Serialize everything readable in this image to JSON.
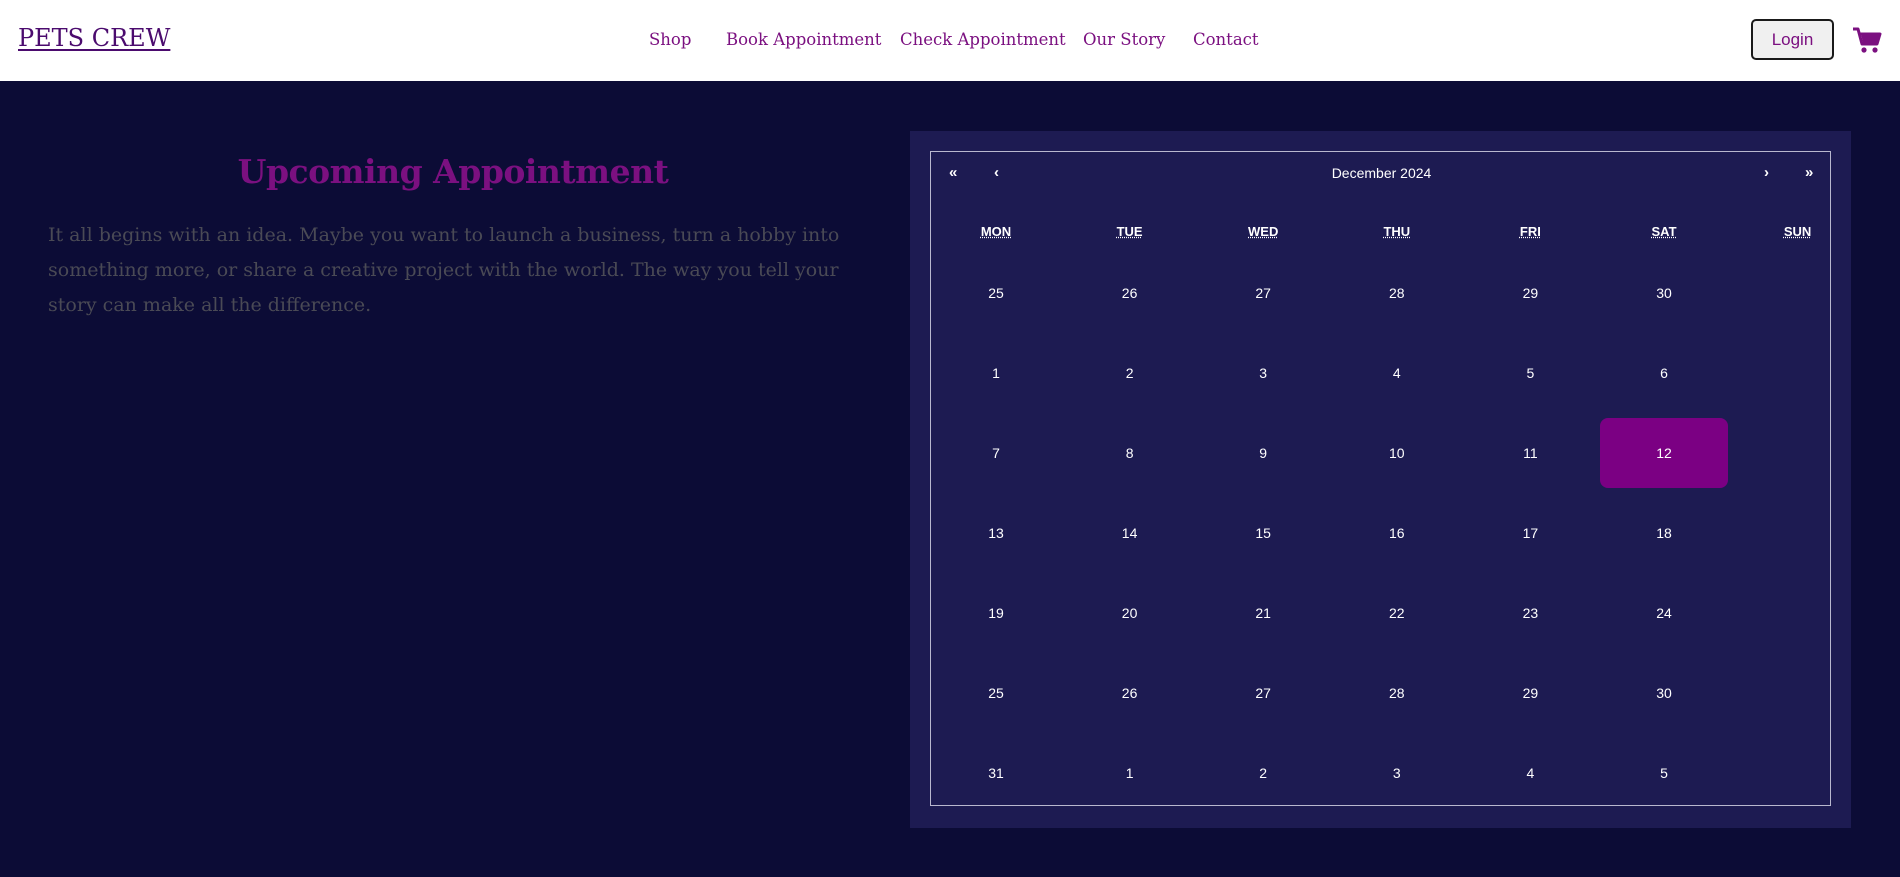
{
  "header": {
    "brand": "PETS CREW",
    "nav": [
      "Shop",
      "Book Appointment",
      "Check Appointment",
      "Our Story",
      "Contact"
    ],
    "login_label": "Login",
    "cart_icon": "cart-icon"
  },
  "appointment": {
    "title": "Upcoming Appointment",
    "body": "It all begins with an idea. Maybe you want to launch a business, turn a hobby into something more, or share a creative project with the world. The way you tell your story can make all the difference."
  },
  "calendar": {
    "prev_year": "«",
    "prev_month": "‹",
    "label": "December 2024",
    "next_month": "›",
    "next_year": "»",
    "weekdays": [
      "MON",
      "TUE",
      "WED",
      "THU",
      "FRI",
      "SAT",
      "SUN"
    ],
    "weeks": [
      [
        "25",
        "26",
        "27",
        "28",
        "29",
        "30",
        ""
      ],
      [
        "1",
        "2",
        "3",
        "4",
        "5",
        "6",
        ""
      ],
      [
        "7",
        "8",
        "9",
        "10",
        "11",
        "12",
        ""
      ],
      [
        "13",
        "14",
        "15",
        "16",
        "17",
        "18",
        ""
      ],
      [
        "19",
        "20",
        "21",
        "22",
        "23",
        "24",
        ""
      ],
      [
        "25",
        "26",
        "27",
        "28",
        "29",
        "30",
        ""
      ],
      [
        "31",
        "1",
        "2",
        "3",
        "4",
        "5",
        ""
      ]
    ],
    "selected": "12",
    "accent": "#7b0083"
  },
  "colors": {
    "page_bg": "#0c0c36",
    "panel_bg": "#1d1b52",
    "brand_purple": "#7b1080"
  }
}
